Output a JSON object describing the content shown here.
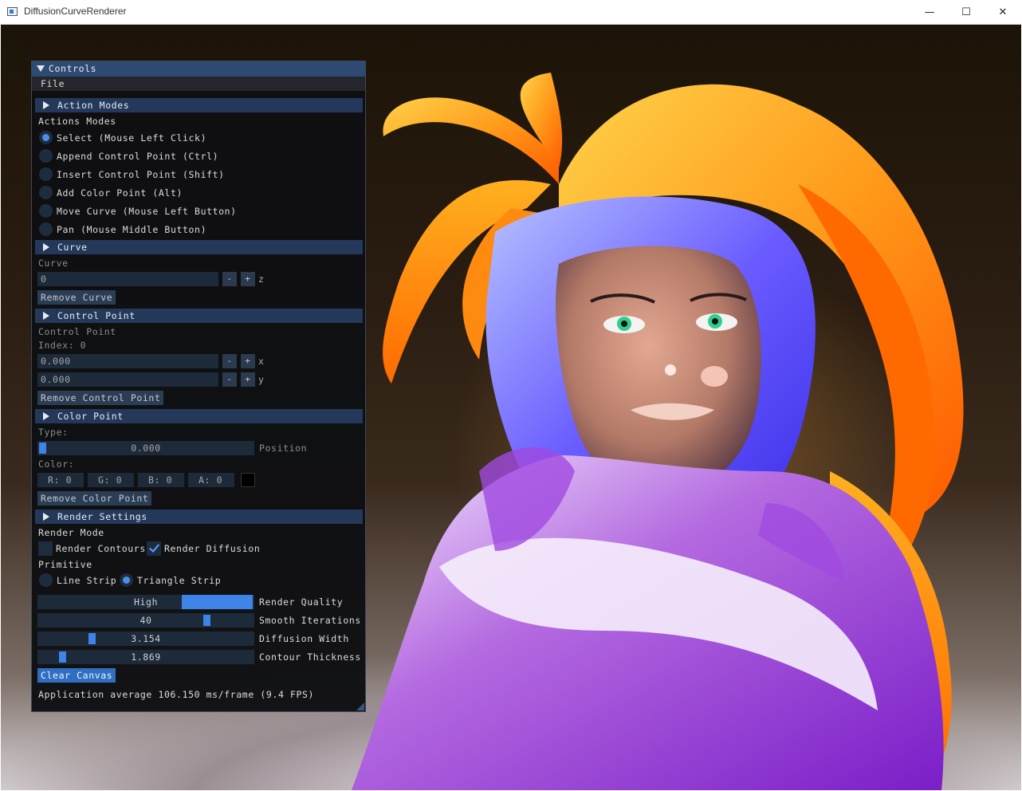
{
  "window": {
    "title": "DiffusionCurveRenderer",
    "minimize_glyph": "—",
    "maximize_glyph": "☐",
    "close_glyph": "✕"
  },
  "panel": {
    "title": "Controls",
    "menu_file": "File",
    "action_modes": {
      "header": "Action Modes",
      "label": "Actions Modes",
      "options": [
        "Select (Mouse Left Click)",
        "Append Control Point (Ctrl)",
        "Insert Control Point (Shift)",
        "Add Color Point (Alt)",
        "Move Curve (Mouse Left Button)",
        "Pan (Mouse Middle Button)"
      ],
      "selected": "Select (Mouse Left Click)"
    },
    "curve": {
      "header": "Curve",
      "label": "Curve",
      "value": "0",
      "minus": "-",
      "plus": "+",
      "axis": "z",
      "remove_button": "Remove Curve"
    },
    "control_point": {
      "header": "Control Point",
      "label": "Control Point",
      "index_label": "Index: 0",
      "x_value": "0.000",
      "y_value": "0.000",
      "x_axis": "x",
      "y_axis": "y",
      "remove_button": "Remove Control Point"
    },
    "color_point": {
      "header": "Color Point",
      "type_label": "Type:",
      "position_value": "0.000",
      "position_label": "Position",
      "color_label": "Color:",
      "r": "R:  0",
      "g": "G:  0",
      "b": "B:  0",
      "a": "A:  0",
      "swatch_color": "#000000",
      "remove_button": "Remove Color Point"
    },
    "render_settings": {
      "header": "Render Settings",
      "render_mode_label": "Render Mode",
      "render_contours": "Render Contours",
      "render_contours_checked": false,
      "render_diffusion": "Render Diffusion",
      "render_diffusion_checked": true,
      "primitive_label": "Primitive",
      "line_strip": "Line Strip",
      "triangle_strip": "Triangle Strip",
      "primitive_selected": "Triangle Strip",
      "quality_value": "High",
      "quality_label": "Render Quality",
      "smooth_value": "40",
      "smooth_label": "Smooth Iterations",
      "diffusion_value": "3.154",
      "diffusion_label": "Diffusion Width",
      "contour_value": "1.869",
      "contour_label": "Contour Thickness",
      "clear_button": "Clear Canvas",
      "fps_text": "Application average 106.150 ms/frame (9.4 FPS)"
    }
  },
  "colors": {
    "accent": "#4a90e8",
    "header": "#24395a",
    "title": "#2e4a72",
    "panel_bg": "#0e0f12"
  }
}
